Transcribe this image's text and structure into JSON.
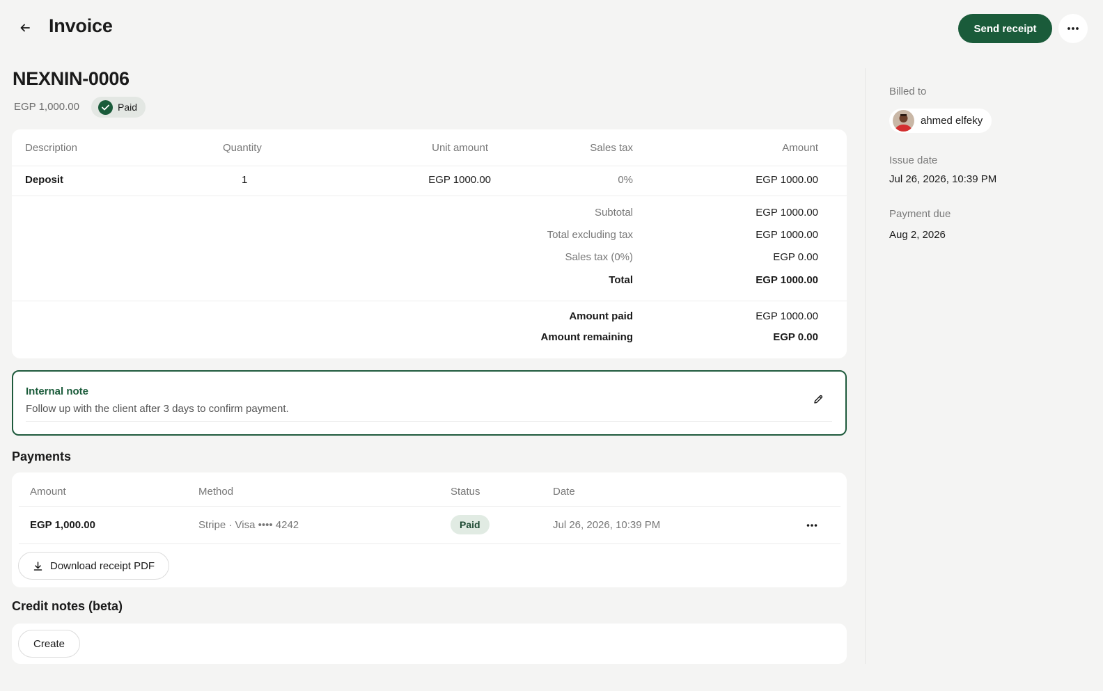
{
  "header": {
    "title": "Invoice",
    "send_label": "Send receipt"
  },
  "invoice": {
    "number": "NEXNIN-0006",
    "amount": "EGP 1,000.00",
    "status": "Paid"
  },
  "items": {
    "columns": [
      "Description",
      "Quantity",
      "Unit amount",
      "Sales tax",
      "Amount"
    ],
    "rows": [
      {
        "description": "Deposit",
        "quantity": "1",
        "unit_amount": "EGP 1000.00",
        "sales_tax": "0%",
        "amount": "EGP 1000.00"
      }
    ],
    "summary": [
      {
        "label": "Subtotal",
        "value": "EGP 1000.00"
      },
      {
        "label": "Total excluding tax",
        "value": "EGP 1000.00"
      },
      {
        "label": "Sales tax (0%)",
        "value": "EGP 0.00"
      },
      {
        "label": "Total",
        "value": "EGP 1000.00"
      }
    ],
    "paid": [
      {
        "label": "Amount paid",
        "value": "EGP 1000.00"
      },
      {
        "label": "Amount remaining",
        "value": "EGP 0.00"
      }
    ]
  },
  "note": {
    "title": "Internal note",
    "text": "Follow up with the client after 3 days to confirm payment."
  },
  "payments": {
    "title": "Payments",
    "columns": [
      "Amount",
      "Method",
      "Status",
      "Date"
    ],
    "rows": [
      {
        "amount": "EGP 1,000.00",
        "method": "Stripe · Visa •••• 4242",
        "status": "Paid",
        "date": "Jul 26, 2026, 10:39 PM"
      }
    ],
    "download_label": "Download receipt PDF"
  },
  "credit_notes": {
    "title": "Credit notes (beta)",
    "create_label": "Create"
  },
  "sidebar": {
    "billed_to_label": "Billed to",
    "billed_to_name": "ahmed elfeky",
    "issue_date_label": "Issue date",
    "issue_date": "Jul 26, 2026, 10:39 PM",
    "payment_due_label": "Payment due",
    "payment_due": "Aug 2, 2026"
  },
  "colors": {
    "accent": "#1a5b3a",
    "background": "#f4f4f3",
    "paid_pill_bg": "#e1ebe3"
  }
}
